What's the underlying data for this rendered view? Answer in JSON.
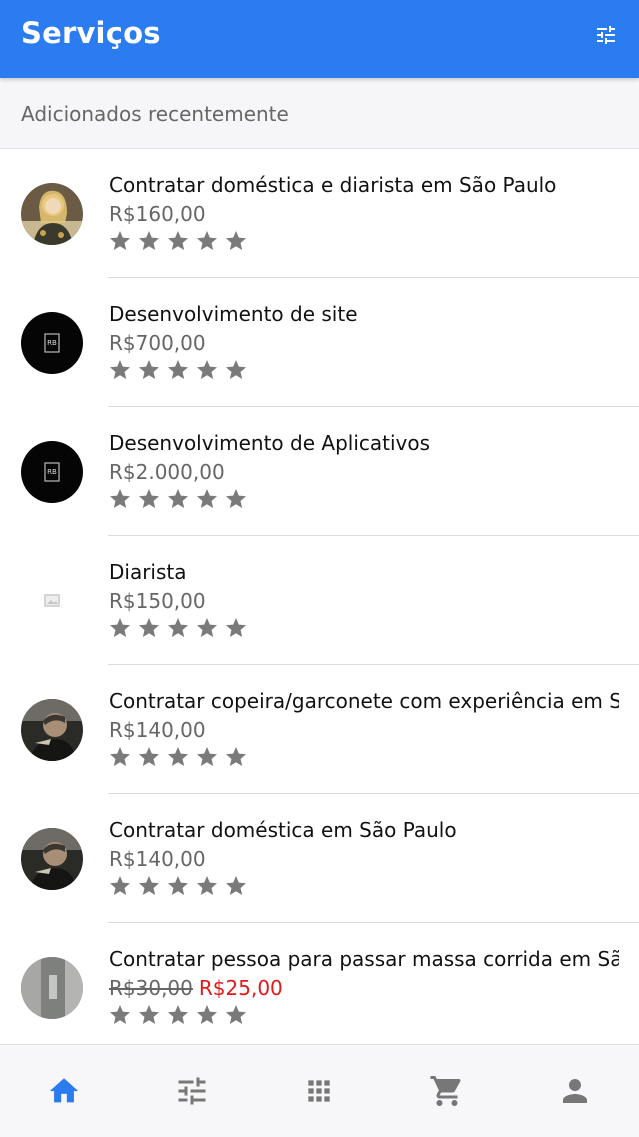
{
  "header": {
    "title": "Serviços",
    "filter_icon": "tune-icon"
  },
  "section": {
    "title": "Adicionados recentemente"
  },
  "items": [
    {
      "title": "Contratar doméstica e diarista em São Paulo",
      "price": "R$160,00",
      "rating": 0,
      "avatar": "photo-woman"
    },
    {
      "title": "Desenvolvimento de site",
      "price": "R$700,00",
      "rating": 0,
      "avatar": "logo-rb"
    },
    {
      "title": "Desenvolvimento de Aplicativos",
      "price": "R$2.000,00",
      "rating": 0,
      "avatar": "logo-rb"
    },
    {
      "title": "Diarista",
      "price": "R$150,00",
      "rating": 0,
      "avatar": "image-placeholder"
    },
    {
      "title": "Contratar copeira/garconete com experiência em São Paulo",
      "price": "R$140,00",
      "rating": 0,
      "avatar": "photo-man"
    },
    {
      "title": "Contratar doméstica em São Paulo",
      "price": "R$140,00",
      "rating": 0,
      "avatar": "photo-man"
    },
    {
      "title": "Contratar pessoa para passar massa corrida em São Paulo",
      "old_price": "R$30,00",
      "sale_price": "R$25,00",
      "rating": 0,
      "avatar": "photo-wall"
    }
  ],
  "bottom_nav": [
    {
      "icon": "home-icon",
      "active": true
    },
    {
      "icon": "tune-icon",
      "active": false
    },
    {
      "icon": "apps-grid-icon",
      "active": false
    },
    {
      "icon": "cart-icon",
      "active": false
    },
    {
      "icon": "person-icon",
      "active": false
    }
  ],
  "colors": {
    "primary": "#2b7cf0",
    "star": "#7a7a7a",
    "sale": "#e0191b",
    "muted": "#666666"
  }
}
